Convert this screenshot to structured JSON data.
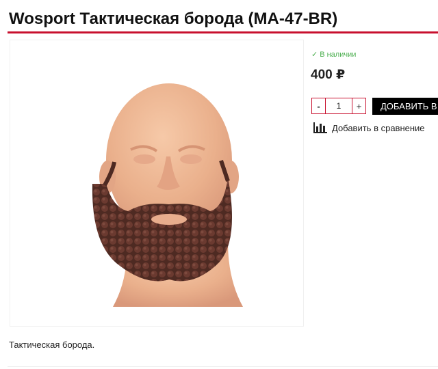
{
  "product": {
    "title": "Wosport Тактическая борода (MA-47-BR)",
    "stock_status": "В наличии",
    "price": "400 ₽",
    "quantity": "1",
    "qty_minus": "-",
    "qty_plus": "+",
    "add_to_cart_label": "ДОБАВИТЬ В КОРЗИНУ",
    "compare_label": "Добавить в сравнение",
    "description": "Тактическая борода."
  },
  "icons": {
    "stock": "check-icon",
    "compare": "bar-chart-icon"
  },
  "colors": {
    "accent": "#c8102e",
    "in_stock": "#4caf50",
    "cart_button": "#000000"
  }
}
